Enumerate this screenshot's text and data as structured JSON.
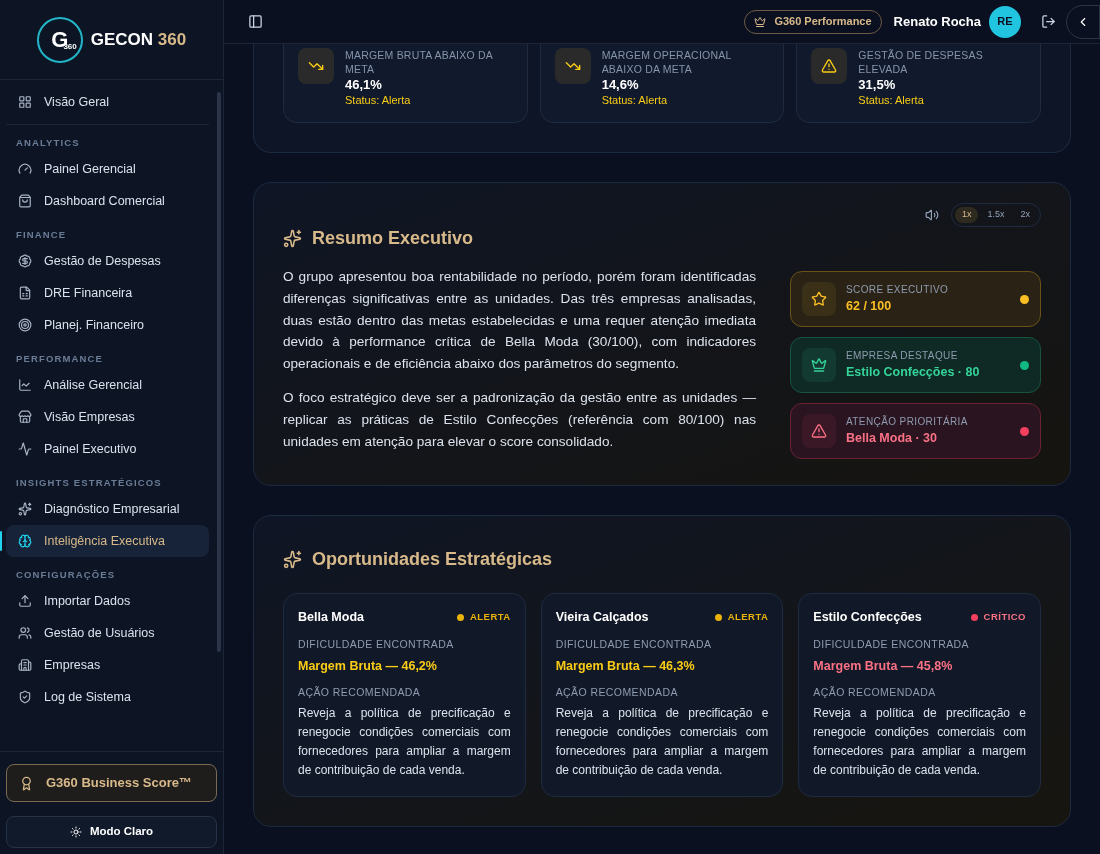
{
  "brand": {
    "logo_letter": "G",
    "logo_sub": "360",
    "name": "GECON",
    "name_accent": "360"
  },
  "sidebar": {
    "top_item": {
      "label": "Visão Geral",
      "kind": "grid",
      "selected": false
    },
    "sections": [
      {
        "title": "ANALYTICS",
        "items": [
          {
            "label": "Painel Gerencial",
            "kind": "gauge",
            "selected": false
          },
          {
            "label": "Dashboard Comercial",
            "kind": "bag",
            "selected": false
          }
        ]
      },
      {
        "title": "FINANCE",
        "items": [
          {
            "label": "Gestão de Despesas",
            "kind": "dollar",
            "selected": false
          },
          {
            "label": "DRE Financeira",
            "kind": "doc",
            "selected": false
          },
          {
            "label": "Planej. Financeiro",
            "kind": "target",
            "selected": false
          }
        ]
      },
      {
        "title": "PERFORMANCE",
        "items": [
          {
            "label": "Análise Gerencial",
            "kind": "chart",
            "selected": false
          },
          {
            "label": "Visão Empresas",
            "kind": "store",
            "selected": false
          },
          {
            "label": "Painel Executivo",
            "kind": "pulse",
            "selected": false
          }
        ]
      },
      {
        "title": "INSIGHTS ESTRATÉGICOS",
        "items": [
          {
            "label": "Diagnóstico Empresarial",
            "kind": "sparkle",
            "selected": false
          },
          {
            "label": "Inteligência Executiva",
            "kind": "brain",
            "selected": true
          }
        ]
      },
      {
        "title": "CONFIGURAÇÕES",
        "items": [
          {
            "label": "Importar Dados",
            "kind": "upload",
            "selected": false
          },
          {
            "label": "Gestão de Usuários",
            "kind": "users",
            "selected": false
          },
          {
            "label": "Empresas",
            "kind": "building",
            "selected": false
          },
          {
            "label": "Log de Sistema",
            "kind": "shield",
            "selected": false
          }
        ]
      }
    ],
    "score_button": "G360 Business Score™",
    "theme_button": "Modo Claro"
  },
  "header": {
    "plan_badge": "G360 Performance",
    "user_name": "Renato Rocha",
    "avatar_initials": "RE"
  },
  "alerts": [
    {
      "label": "MARGEM BRUTA ABAIXO DA META",
      "value": "46,1%",
      "status": "Status: Alerta",
      "kind": "trend-down"
    },
    {
      "label": "MARGEM OPERACIONAL ABAIXO DA META",
      "value": "14,6%",
      "status": "Status: Alerta",
      "kind": "trend-down"
    },
    {
      "label": "GESTÃO DE DESPESAS ELEVADA",
      "value": "31,5%",
      "status": "Status: Alerta",
      "kind": "warning"
    }
  ],
  "summary": {
    "title": "Resumo Executivo",
    "speeds": [
      {
        "label": "1x",
        "selected": true
      },
      {
        "label": "1.5x",
        "selected": false
      },
      {
        "label": "2x",
        "selected": false
      }
    ],
    "paragraphs": [
      "O grupo apresentou boa rentabilidade no período, porém foram identificadas diferenças significativas entre as unidades. Das três empresas analisadas, duas estão dentro das metas estabelecidas e uma requer atenção imediata devido à performance crítica de Bella Moda (30/100), com indicadores operacionais e de eficiência abaixo dos parâmetros do segmento.",
      "O foco estratégico deve ser a padronização da gestão entre as unidades — replicar as práticas de Estilo Confecções (referência com 80/100) nas unidades em atenção para elevar o score consolidado."
    ],
    "highlights": [
      {
        "label": "SCORE EXECUTIVO",
        "value": "62 / 100",
        "kind": "star",
        "color": "#fbbf24"
      },
      {
        "label": "EMPRESA DESTAQUE",
        "value": "Estilo Confecções · 80",
        "kind": "crown",
        "color": "#10b981"
      },
      {
        "label": "ATENÇÃO PRIORITÁRIA",
        "value": "Bella Moda · 30",
        "kind": "warning",
        "color": "#f43f5e"
      }
    ]
  },
  "opportunities": {
    "title": "Oportunidades Estratégicas",
    "cards": [
      {
        "company": "Bella Moda",
        "status": "ALERTA",
        "color": "#eab308",
        "difficulty_label": "DIFICULDADE ENCONTRADA",
        "difficulty": "Margem Bruta — 46,2%",
        "action_label": "AÇÃO RECOMENDADA",
        "action": "Reveja a política de precificação e renegocie condições comerciais com fornecedores para ampliar a margem de contribuição de cada venda."
      },
      {
        "company": "Vieira Calçados",
        "status": "ALERTA",
        "color": "#eab308",
        "difficulty_label": "DIFICULDADE ENCONTRADA",
        "difficulty": "Margem Bruta — 46,3%",
        "action_label": "AÇÃO RECOMENDADA",
        "action": "Reveja a política de precificação e renegocie condições comerciais com fornecedores para ampliar a margem de contribuição de cada venda."
      },
      {
        "company": "Estilo Confecções",
        "status": "CRÍTICO",
        "color": "#f43f5e",
        "difficulty_label": "DIFICULDADE ENCONTRADA",
        "difficulty": "Margem Bruta — 45,8%",
        "action_label": "AÇÃO RECOMENDADA",
        "action": "Reveja a política de precificação e renegocie condições comerciais com fornecedores para ampliar a margem de contribuição de cada venda."
      }
    ]
  }
}
